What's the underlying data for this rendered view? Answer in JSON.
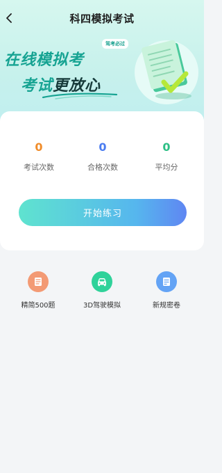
{
  "header": {
    "title": "科四模拟考试"
  },
  "banner": {
    "line1": "在线模拟考",
    "line2_part1": "考试",
    "line2_part2": "更放心",
    "badge": "驾考必过"
  },
  "stats": [
    {
      "value": "0",
      "label": "考试次数",
      "color": "#f08c2a"
    },
    {
      "value": "0",
      "label": "合格次数",
      "color": "#4a7cf0"
    },
    {
      "value": "0",
      "label": "平均分",
      "color": "#2dbf85"
    }
  ],
  "start_button": "开始练习",
  "shortcuts": [
    {
      "label": "精简500题",
      "icon": "document-icon",
      "color": "#f39a74"
    },
    {
      "label": "3D驾驶模拟",
      "icon": "car-icon",
      "color": "#2fd29a"
    },
    {
      "label": "新规密卷",
      "icon": "notes-icon",
      "color": "#63a3f5"
    }
  ],
  "colors": {
    "brand": "#16a392",
    "button_start": "#5fe3cf",
    "button_end": "#5f86f2"
  }
}
